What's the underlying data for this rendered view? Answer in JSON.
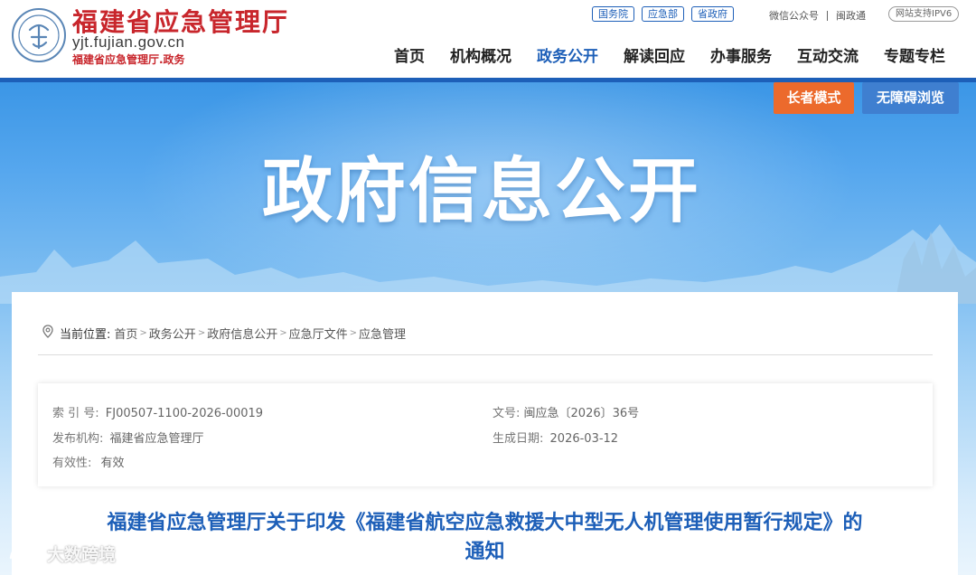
{
  "header": {
    "site_title": "福建省应急管理厅",
    "domain": "yjt.fujian.gov.cn",
    "subtitle": "福建省应急管理厅.政务",
    "top_links": [
      "国务院",
      "应急部",
      "省政府"
    ],
    "wechat": "微信公众号",
    "minzhengtong": "闽政通",
    "ipv6": "网站支持IPV6",
    "nav": [
      "首页",
      "机构概况",
      "政务公开",
      "解读回应",
      "办事服务",
      "互动交流",
      "专题专栏"
    ],
    "active_nav": "政务公开",
    "brand_color": "#1d5fb8",
    "title_color": "#c8262c"
  },
  "banner": {
    "title": "政府信息公开",
    "elder_mode": "长者模式",
    "accessibility": "无障碍浏览",
    "elder_color": "#ec6a2c",
    "access_color": "#3f7fd0"
  },
  "breadcrumb": {
    "label": "当前位置:",
    "items": [
      "首页",
      "政务公开",
      "政府信息公开",
      "应急厅文件",
      "应急管理"
    ]
  },
  "meta": {
    "index_label": "索 引 号:",
    "index_value": "FJ00507-1100-2026-00019",
    "doc_no_label": "文号:",
    "doc_no_value": "闽应急〔2026〕36号",
    "publisher_label": "发布机构:",
    "publisher_value": "福建省应急管理厅",
    "date_label": "生成日期:",
    "date_value": "2026-03-12",
    "validity_label": "有效性:",
    "validity_value": "有效"
  },
  "document": {
    "title_line1": "福建省应急管理厅关于印发《福建省航空应急救援大中型无人机管理使用暂行规定》的",
    "title_line2": "通知"
  },
  "watermark": "大数跨境"
}
